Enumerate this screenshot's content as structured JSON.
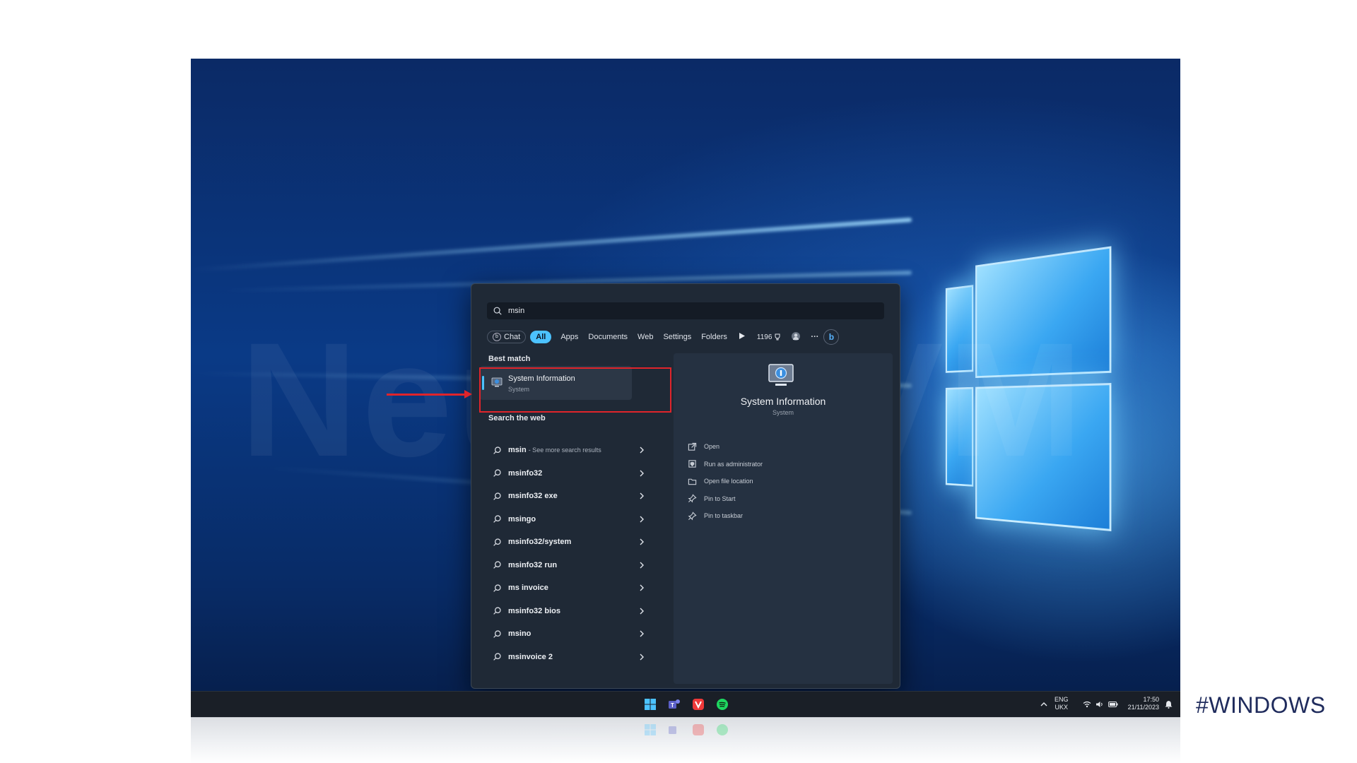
{
  "search": {
    "query": "msin"
  },
  "filters": [
    "Chat",
    "All",
    "Apps",
    "Documents",
    "Web",
    "Settings",
    "Folders"
  ],
  "filters_extra": {
    "points": "1196"
  },
  "best_match": {
    "heading": "Best match",
    "title": "System Information",
    "subtitle": "System"
  },
  "search_web": {
    "heading": "Search the web",
    "items": [
      {
        "label": "msin",
        "extra": "- See more search results"
      },
      {
        "label": "msinfo32",
        "extra": ""
      },
      {
        "label": "msinfo32 exe",
        "extra": ""
      },
      {
        "label": "msingo",
        "extra": ""
      },
      {
        "label": "msinfo32/system",
        "extra": ""
      },
      {
        "label": "msinfo32 run",
        "extra": ""
      },
      {
        "label": "ms invoice",
        "extra": ""
      },
      {
        "label": "msinfo32 bios",
        "extra": ""
      },
      {
        "label": "msino",
        "extra": ""
      },
      {
        "label": "msinvoice 2",
        "extra": ""
      }
    ]
  },
  "preview": {
    "title": "System Information",
    "subtitle": "System",
    "actions": [
      "Open",
      "Run as administrator",
      "Open file location",
      "Pin to Start",
      "Pin to taskbar"
    ]
  },
  "taskbar": {
    "language": "ENG",
    "layout": "UKX",
    "time": "17:50",
    "date": "21/11/2023"
  },
  "watermark": "NeuronVM",
  "hashtag": "#WINDOWS",
  "colors": {
    "accent": "#4cc2ff",
    "highlight": "#e0242b",
    "panel": "#1f2936"
  }
}
